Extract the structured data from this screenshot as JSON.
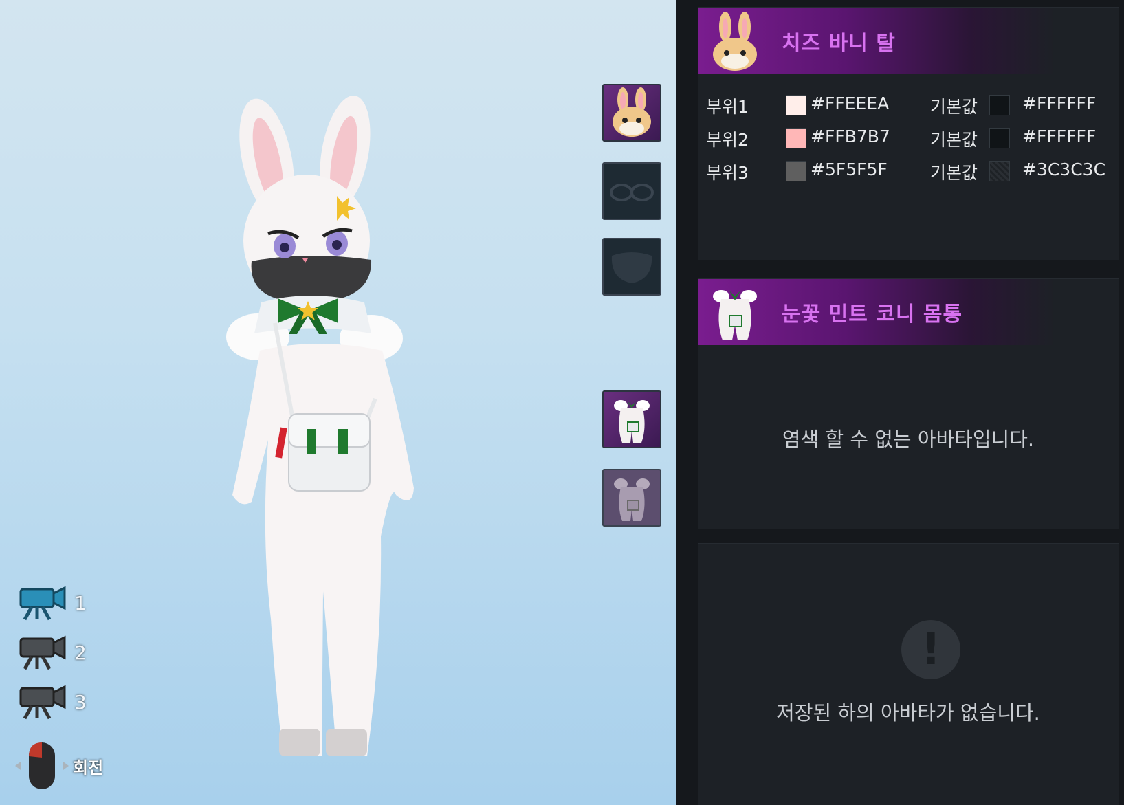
{
  "cameras": [
    {
      "label": "1"
    },
    {
      "label": "2"
    },
    {
      "label": "3"
    }
  ],
  "controls": {
    "rotate_label": "회전"
  },
  "slots": [
    {
      "icon": "bunny-head-icon",
      "state": "active"
    },
    {
      "icon": "glasses-icon",
      "state": "empty"
    },
    {
      "icon": "mask-icon",
      "state": "empty"
    },
    {
      "icon": "body-costume-icon",
      "state": "active"
    },
    {
      "icon": "body-costume-icon",
      "state": "faded"
    }
  ],
  "head_item": {
    "title": "치즈 바니 탈",
    "dye_rows": [
      {
        "part": "부위1",
        "color": "#FFEEEA",
        "default_label": "기본값",
        "default_color": "#FFFFFF",
        "swatch": "#FFEEEA",
        "default_swatch": "#101417"
      },
      {
        "part": "부위2",
        "color": "#FFB7B7",
        "default_label": "기본값",
        "default_color": "#FFFFFF",
        "swatch": "#FFB7B7",
        "default_swatch": "#101417"
      },
      {
        "part": "부위3",
        "color": "#5F5F5F",
        "default_label": "기본값",
        "default_color": "#3C3C3C",
        "swatch": "#5F5F5F",
        "default_swatch": "#1e2226"
      }
    ]
  },
  "body_item": {
    "title": "눈꽃 민트 코니 몸통",
    "message": "염색 할 수 없는 아바타입니다."
  },
  "bottom_item": {
    "message": "저장된 하의 아바타가 없습니다."
  },
  "colors": {
    "accent": "#d872f0",
    "header_purple": "#7a1d8f"
  }
}
